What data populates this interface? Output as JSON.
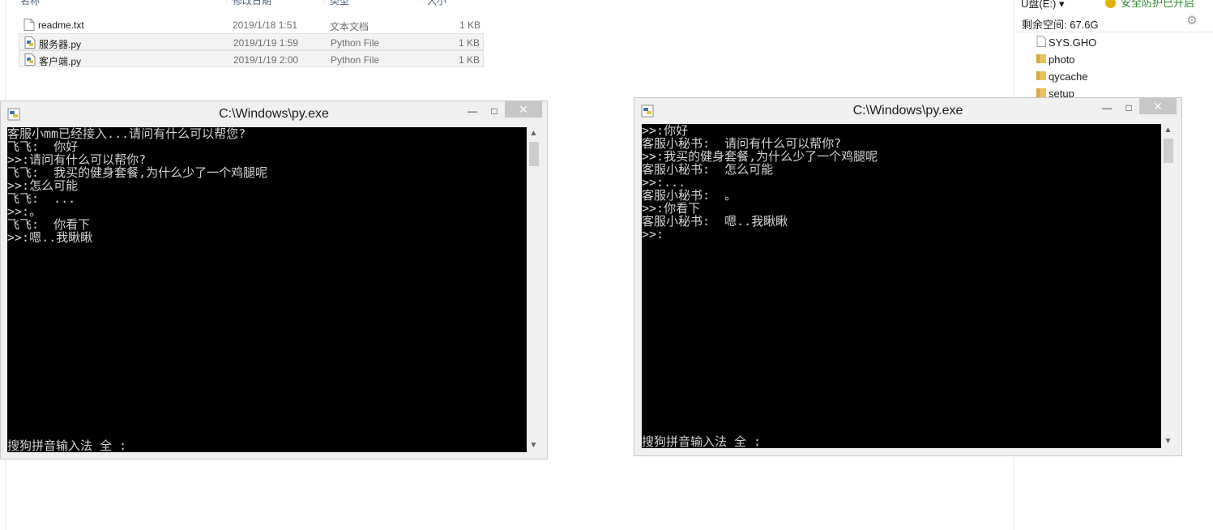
{
  "explorer": {
    "columns": [
      "名称",
      "修改日期",
      "类型",
      "大小"
    ],
    "files": [
      {
        "name": "readme.txt",
        "date": "2019/1/18 1:51",
        "type": "文本文档",
        "size": "1 KB",
        "icon": "text-file-icon"
      },
      {
        "name": "服务器.py",
        "date": "2019/1/19 1:59",
        "type": "Python File",
        "size": "1 KB",
        "icon": "python-file-icon"
      },
      {
        "name": "客户端.py",
        "date": "2019/1/19 2:00",
        "type": "Python File",
        "size": "1 KB",
        "icon": "python-file-icon"
      }
    ]
  },
  "nav": {
    "drive_label": "U盘(E:) ▾",
    "protect_label": "安全防护已开启",
    "free_space": "剩余空间: 67.6G",
    "gear_icon": "gear-icon",
    "items": [
      {
        "label": "SYS.GHO",
        "icon": "file-icon"
      },
      {
        "label": "photo",
        "icon": "folder-icon"
      },
      {
        "label": "qycache",
        "icon": "folder-icon"
      },
      {
        "label": "setup",
        "icon": "folder-icon"
      }
    ]
  },
  "windows": [
    {
      "title": "C:\\Windows\\py.exe",
      "minimize": "—",
      "maximize": "□",
      "close": "✕",
      "lines": [
        "客服小mm已经接入...请问有什么可以帮您?",
        "飞飞:  你好",
        ">>:请问有什么可以帮你?",
        "飞飞:  我买的健身套餐,为什么少了一个鸡腿呢",
        ">>:怎么可能",
        "飞飞:  ...",
        ">>:。",
        "飞飞:  你看下",
        ">>:嗯..我瞅瞅"
      ],
      "ime": "搜狗拼音输入法 全 :"
    },
    {
      "title": "C:\\Windows\\py.exe",
      "minimize": "—",
      "maximize": "□",
      "close": "✕",
      "lines": [
        ">>:你好",
        "客服小秘书:  请问有什么可以帮你?",
        ">>:我买的健身套餐,为什么少了一个鸡腿呢",
        "客服小秘书:  怎么可能",
        ">>:...",
        "客服小秘书:  。",
        ">>:你看下",
        "客服小秘书:  嗯..我瞅瞅",
        ">>:"
      ],
      "ime": "搜狗拼音输入法 全 :"
    }
  ],
  "colors": {
    "console_bg": "#000000",
    "console_text": "#d4d4d4",
    "close_button": "#c7c7c7",
    "protect_green": "#2d8a2d"
  }
}
